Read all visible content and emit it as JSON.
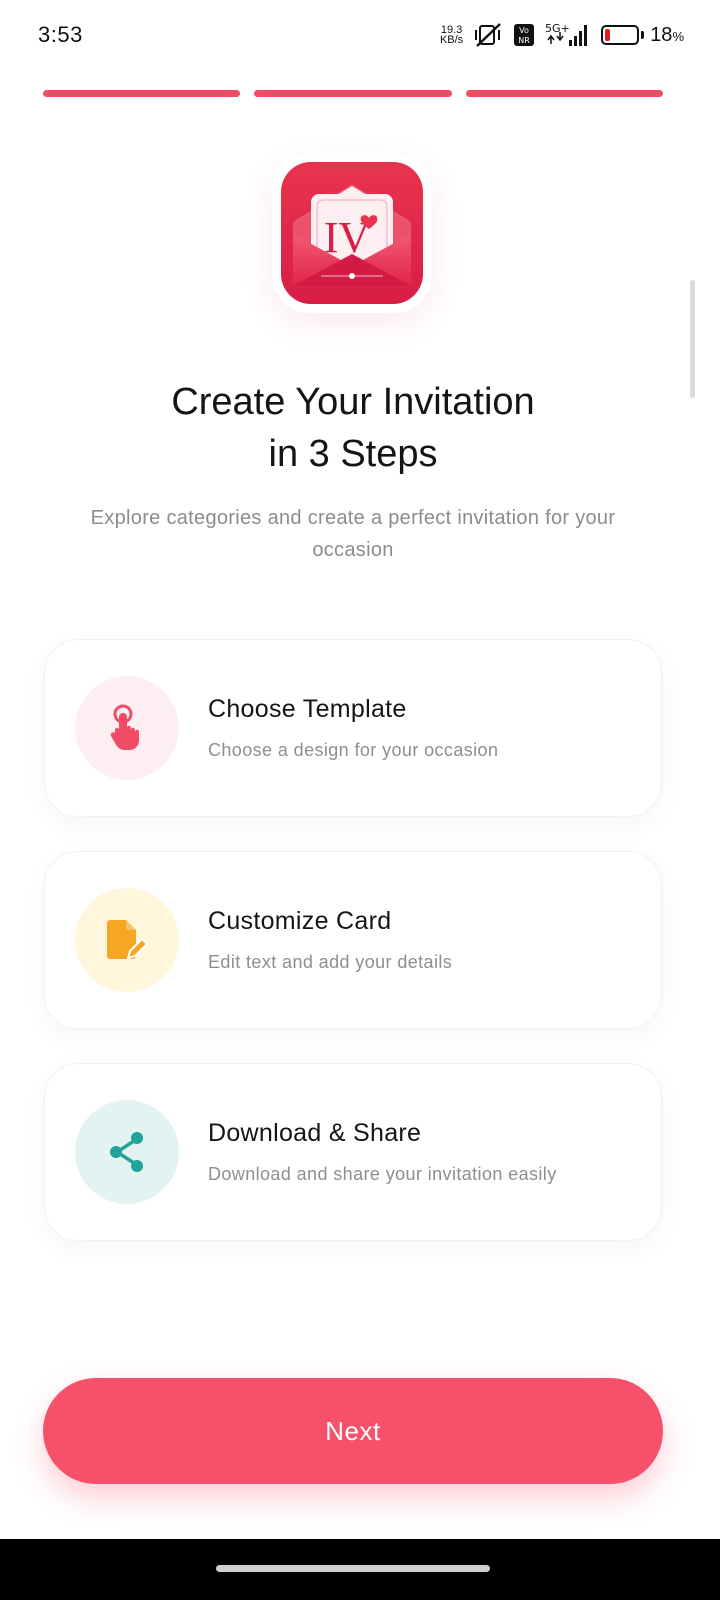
{
  "status_bar": {
    "time": "3:53",
    "net_speed_value": "19.3",
    "net_speed_unit": "KB/s",
    "volte_label_top": "Vo",
    "volte_label_bottom": "NR",
    "network": "5G+",
    "battery_percent": "18",
    "battery_percent_sign": "%",
    "battery_level": 0.18,
    "icons": [
      "mute-vibrate-icon",
      "volte-icon",
      "signal-icon",
      "battery-icon"
    ]
  },
  "onboarding": {
    "progress_steps": 3,
    "progress_color": "#f04c66",
    "app_logo_text": "IV",
    "title_line1": "Create Your Invitation",
    "title_line2": "in 3 Steps",
    "subtitle": "Explore categories and create a perfect invitation for your occasion"
  },
  "steps": [
    {
      "title": "Choose Template",
      "description": "Choose a design for your occasion",
      "icon": "tap-finger-icon",
      "icon_color": "#f04c66",
      "icon_bg": "#fdeef1"
    },
    {
      "title": "Customize Card",
      "description": "Edit text and add your details",
      "icon": "edit-document-icon",
      "icon_color": "#f5a623",
      "icon_bg": "#fff6dc"
    },
    {
      "title": "Download & Share",
      "description": "Download and share your invitation easily",
      "icon": "share-icon",
      "icon_color": "#1fa39a",
      "icon_bg": "#e2f3f2"
    }
  ],
  "actions": {
    "next_label": "Next",
    "next_color": "#f7506a"
  }
}
